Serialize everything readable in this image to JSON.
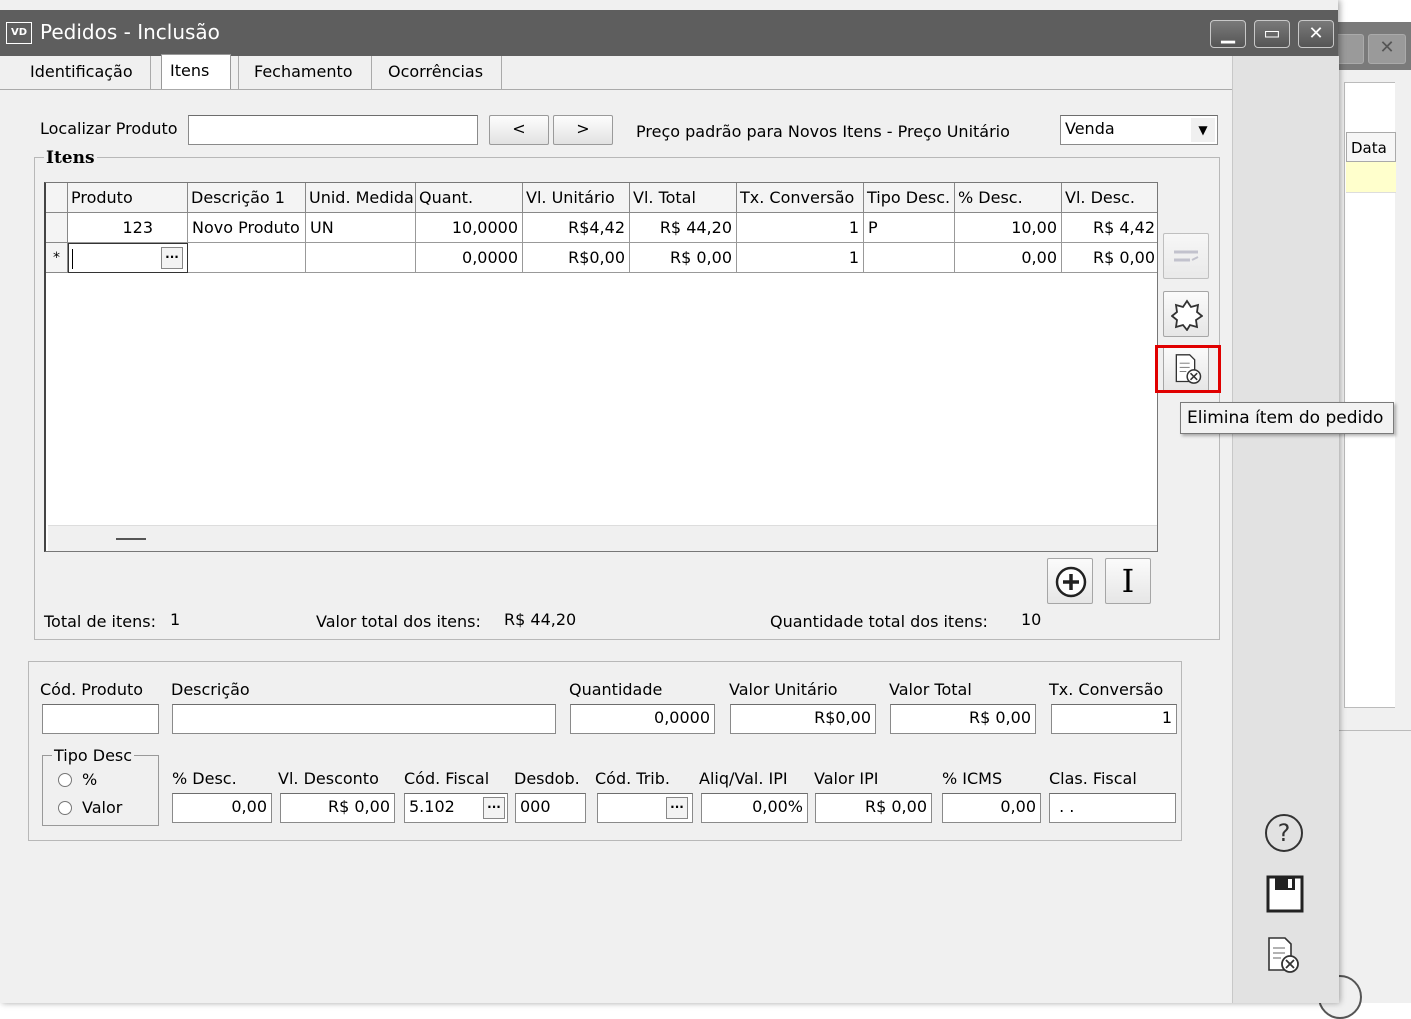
{
  "window": {
    "title": "Pedidos - Inclusão",
    "app_icon": "VD",
    "controls": [
      "minimize-icon",
      "maximize-icon",
      "close-icon"
    ]
  },
  "background_window": {
    "grid_header": "Data"
  },
  "tabs": [
    {
      "label": "Identificação",
      "active": false
    },
    {
      "label": "Itens",
      "active": true
    },
    {
      "label": "Fechamento",
      "active": false
    },
    {
      "label": "Ocorrências",
      "active": false
    }
  ],
  "search": {
    "label": "Localizar Produto",
    "value": "",
    "prev_label": "<",
    "next_label": ">",
    "price_label": "Preço padrão para Novos Itens - Preço Unitário",
    "price_select": "Venda"
  },
  "items_group": {
    "title": "Itens",
    "columns": [
      "Produto",
      "Descrição 1",
      "Unid. Medida",
      "Quant.",
      "Vl. Unitário",
      "Vl. Total",
      "Tx. Conversão",
      "Tipo Desc.",
      "% Desc.",
      "Vl. Desc."
    ],
    "rows": [
      {
        "indicator": "",
        "produto": "123",
        "descricao": "Novo Produto",
        "unid": "UN",
        "quant": "10,0000",
        "vl_unit": "R$4,42",
        "vl_total": "R$ 44,20",
        "tx_conv": "1",
        "tipo_desc": "P",
        "pct_desc": "10,00",
        "vl_desc": "R$ 4,42"
      },
      {
        "indicator": "*",
        "produto": "",
        "descricao": "",
        "unid": "",
        "quant": "0,0000",
        "vl_unit": "R$0,00",
        "vl_total": "R$ 0,00",
        "tx_conv": "1",
        "tipo_desc": "",
        "pct_desc": "0,00",
        "vl_desc": "R$ 0,00"
      }
    ],
    "footer": {
      "total_itens_label": "Total de itens:",
      "total_itens_value": "1",
      "valor_total_label": "Valor total dos itens:",
      "valor_total_value": "R$ 44,20",
      "qtd_total_label": "Quantidade total dos itens:",
      "qtd_total_value": "10"
    }
  },
  "tooltip": "Elimina ítem do pedido",
  "detail": {
    "cod_produto": {
      "label": "Cód. Produto",
      "value": ""
    },
    "descricao": {
      "label": "Descrição",
      "value": ""
    },
    "quantidade": {
      "label": "Quantidade",
      "value": "0,0000"
    },
    "valor_unitario": {
      "label": "Valor Unitário",
      "value": "R$0,00"
    },
    "valor_total": {
      "label": "Valor Total",
      "value": "R$ 0,00"
    },
    "tx_conversao": {
      "label": "Tx. Conversão",
      "value": "1"
    },
    "tipo_desc": {
      "label": "Tipo Desc",
      "option_pct": "%",
      "option_valor": "Valor"
    },
    "pct_desc": {
      "label": "% Desc.",
      "value": "0,00"
    },
    "vl_desconto": {
      "label": "Vl. Desconto",
      "value": "R$ 0,00"
    },
    "cod_fiscal": {
      "label": "Cód. Fiscal",
      "value": "5.102"
    },
    "desdob": {
      "label": "Desdob.",
      "value": "000"
    },
    "cod_trib": {
      "label": "Cód. Trib.",
      "value": ""
    },
    "aliq_ipi": {
      "label": "Aliq/Val. IPI",
      "value": "0,00%"
    },
    "valor_ipi": {
      "label": "Valor IPI",
      "value": "R$ 0,00"
    },
    "pct_icms": {
      "label": "% ICMS",
      "value": "0,00"
    },
    "clas_fiscal": {
      "label": "Clas. Fiscal",
      "value": " . ."
    }
  },
  "item_buttons": {
    "add": "+",
    "insert": "I"
  },
  "colors": {
    "titlebar": "#5e5e5e",
    "highlight": "#e00000",
    "window_bg": "#f0f0f0"
  }
}
